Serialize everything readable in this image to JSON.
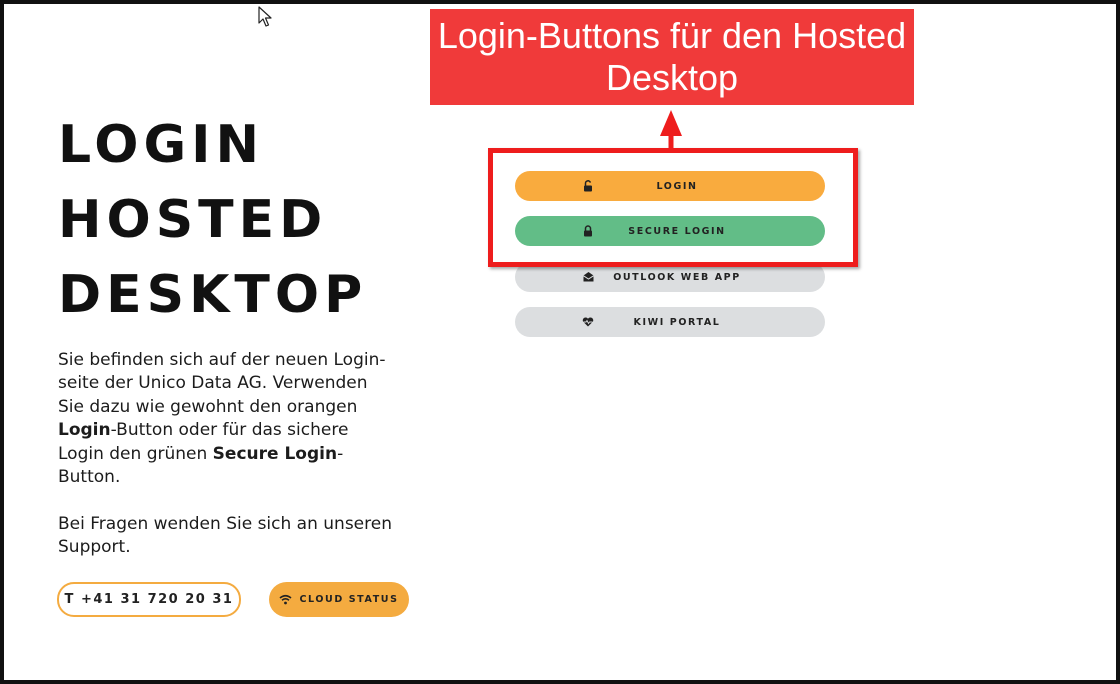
{
  "hero": {
    "title_lines": [
      "LOGIN",
      "HOSTED",
      "DESKTOP"
    ],
    "intro_part1": "Sie befinden sich auf der neuen Login-seite der Unico Data AG. Verwenden Sie dazu wie gewohnt den orangen ",
    "intro_bold1": "Login",
    "intro_part2": "-Button oder für das sichere Login den grünen ",
    "intro_bold2": "Secure Login",
    "intro_part3": "-Button.",
    "support_text": "Bei Fragen wenden Sie sich an unseren Support."
  },
  "contact": {
    "phone_label": "T +41 31 720 20 31",
    "status_label": "CLOUD STATUS",
    "status_icon": "wifi-icon"
  },
  "login_buttons": [
    {
      "label": "LOGIN",
      "icon": "unlock-icon",
      "color": "#f9ab3e"
    },
    {
      "label": "SECURE LOGIN",
      "icon": "lock-icon",
      "color": "#62bd87"
    },
    {
      "label": "OUTLOOK WEB APP",
      "icon": "envelope-icon",
      "color": "#dcdee0"
    },
    {
      "label": "KIWI PORTAL",
      "icon": "heart-icon",
      "color": "#dcdee0"
    }
  ],
  "annotation": {
    "callout_text": "Login-Buttons für den Hosted Desktop",
    "color": "#ee1d1d"
  },
  "colors": {
    "orange": "#f4ab40",
    "green": "#62bd87",
    "grey": "#dcdee0"
  }
}
